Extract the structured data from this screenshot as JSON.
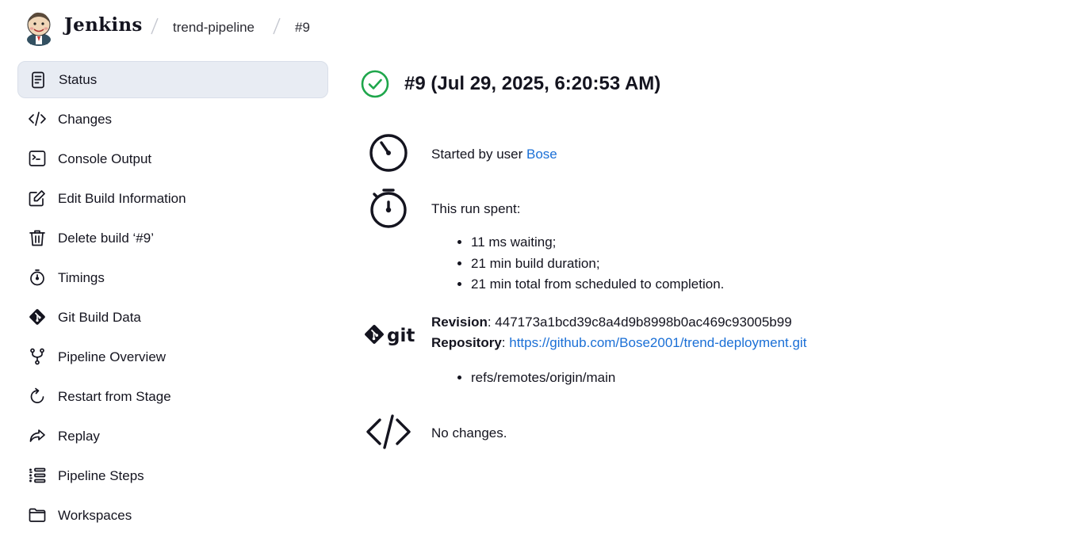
{
  "header": {
    "brand": "Jenkins",
    "breadcrumbs": [
      "trend-pipeline",
      "#9"
    ]
  },
  "sidebar": {
    "items": [
      {
        "label": "Status",
        "icon": "document-icon",
        "active": true
      },
      {
        "label": "Changes",
        "icon": "code-icon"
      },
      {
        "label": "Console Output",
        "icon": "terminal-icon"
      },
      {
        "label": "Edit Build Information",
        "icon": "edit-icon"
      },
      {
        "label": "Delete build ‘#9’",
        "icon": "trash-icon"
      },
      {
        "label": "Timings",
        "icon": "stopwatch-icon"
      },
      {
        "label": "Git Build Data",
        "icon": "git-icon"
      },
      {
        "label": "Pipeline Overview",
        "icon": "branch-icon"
      },
      {
        "label": "Restart from Stage",
        "icon": "restart-icon"
      },
      {
        "label": "Replay",
        "icon": "replay-icon"
      },
      {
        "label": "Pipeline Steps",
        "icon": "list-icon"
      },
      {
        "label": "Workspaces",
        "icon": "folder-icon"
      }
    ]
  },
  "main": {
    "title": "#9 (Jul 29, 2025, 6:20:53 AM)",
    "status": "success",
    "started_by_prefix": "Started by user ",
    "started_by_user": "Bose",
    "run_spent_label": "This run spent:",
    "run_spent_items": [
      "11 ms waiting;",
      "21 min build duration;",
      "21 min total from scheduled to completion."
    ],
    "revision_label": "Revision",
    "revision_value": ": 447173a1bcd39c8a4d9b8998b0ac469c93005b99",
    "repository_label": "Repository",
    "repository_sep": ": ",
    "repository_url": "https://github.com/Bose2001/trend-deployment.git",
    "refs": [
      "refs/remotes/origin/main"
    ],
    "git_logo_text": "git",
    "changes_text": "No changes."
  },
  "colors": {
    "success": "#1ea64b",
    "link": "#1a6fd6",
    "active_bg": "#e8ecf3"
  }
}
